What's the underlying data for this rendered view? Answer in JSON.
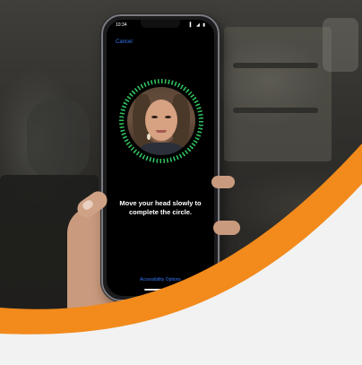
{
  "status_bar": {
    "time": "10:34",
    "icons": "▍ ◢ ▮"
  },
  "face_id_setup": {
    "cancel_label": "Cancel",
    "instruction": "Move your head slowly to complete the circle.",
    "accessibility_options_label": "Accessibility Options"
  },
  "colors": {
    "ring_green": "#2fc25c",
    "link_blue": "#3478f6",
    "accent_orange": "#f28a1c"
  }
}
